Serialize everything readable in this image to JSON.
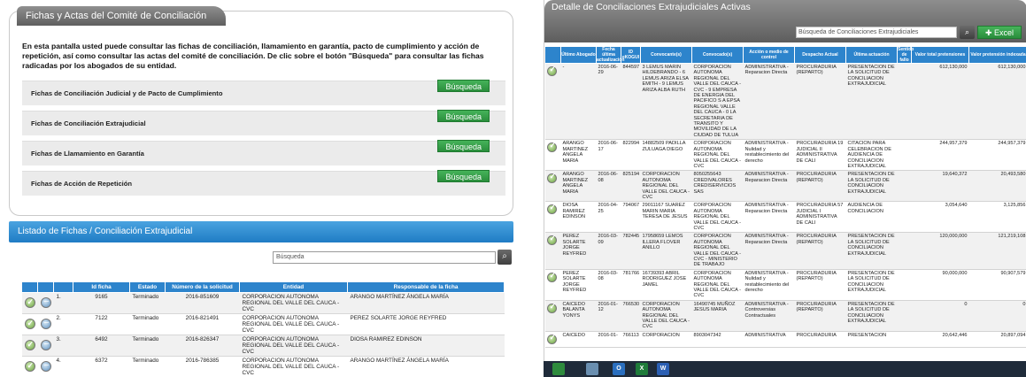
{
  "left": {
    "title": "Fichas y Actas del Comité de Conciliación",
    "intro": "En esta pantalla usted puede consultar las fichas de conciliación, llamamiento en garantía, pacto de cumplimiento y acción de repetición, así como consultar las actas del comité de conciliación. De clic sobre el botón \"Búsqueda\" para consultar las fichas radicadas por los abogados de su entidad.",
    "rows": [
      {
        "label": "Fichas de Conciliación Judicial y de Pacto de Cumplimiento",
        "button": "Búsqueda"
      },
      {
        "label": "Fichas de Conciliación Extrajudicial",
        "button": "Búsqueda"
      },
      {
        "label": "Fichas de Llamamiento en Garantía",
        "button": "Búsqueda"
      },
      {
        "label": "Fichas de Acción de Repetición",
        "button": "Búsqueda"
      }
    ],
    "list_title": "Listado de Fichas / Conciliación Extrajudicial",
    "search_placeholder": "Búsqueda",
    "table": {
      "headers": [
        "",
        "",
        "",
        "Id ficha",
        "Estado",
        "Número de la solicitud",
        "Entidad",
        "Responsable de la ficha"
      ],
      "rows": [
        {
          "n": "1.",
          "id": "9165",
          "estado": "Terminado",
          "sol": "2016-851609",
          "entidad": "CORPORACION AUTONOMA REGIONAL DEL VALLE DEL CAUCA -CVC",
          "resp": "ARANGO MARTÍNEZ ÁNGELA MARÍA"
        },
        {
          "n": "2.",
          "id": "7122",
          "estado": "Terminado",
          "sol": "2016-821491",
          "entidad": "CORPORACION AUTONOMA REGIONAL DEL VALLE DEL CAUCA -CVC",
          "resp": "PEREZ SOLARTE JORGE REYFRED"
        },
        {
          "n": "3.",
          "id": "6492",
          "estado": "Terminado",
          "sol": "2016-826347",
          "entidad": "CORPORACION AUTONOMA REGIONAL DEL VALLE DEL CAUCA -CVC",
          "resp": "DIOSA RAMIREZ EDINSON"
        },
        {
          "n": "4.",
          "id": "6372",
          "estado": "Terminado",
          "sol": "2016-786385",
          "entidad": "CORPORACION AUTONOMA REGIONAL DEL VALLE DEL CAUCA -CVC",
          "resp": "ARANGO MARTÍNEZ ÁNGELA MARÍA"
        }
      ]
    }
  },
  "right": {
    "title": "Detalle de Conciliaciones Extrajudiciales Activas",
    "search_placeholder": "Búsqueda de Conciliaciones Extrajudiciales",
    "excel_label": "Excel",
    "headers": [
      "",
      "Último Abogado",
      "Fecha última actualización",
      "ID eKOGUI",
      "Convocante(s)",
      "Convocado(s)",
      "Acción o medio de control",
      "Despacho Actual",
      "Última actuación",
      "Sentido de fallo",
      "Valor total pretensiones",
      "Valor pretensión indexada"
    ],
    "rows": [
      {
        "abog": "-",
        "fecha": "2016-06-29",
        "id": "844597",
        "convocante": "3 LEMUS MARIN HILDEBRANDO - 6 LEMUS ARIZA ELSA EMITH - 9 LEMUS ARIZA ALBA RUTH",
        "convocado": "CORPORACION AUTONOMA REGIONAL DEL VALLE DEL CAUCA -CVC - 9 EMPRESA DE ENERGIA DEL PACIFICO S A EPSA REGIONAL VALLE DEL CAUCA - 0 LA SECRETARIA DE TRANSITO Y MOVILIDAD DE LA CIUDAD DE TULUA",
        "accion": "ADMINISTRATIVA - Reparacion Directa",
        "despacho": "PROCURADURIA (REPARTO)",
        "ultima": "PRESENTACION DE LA SOLICITUD DE CONCILIACION EXTRAJUDICIAL",
        "sentido": "",
        "valor": "612,130,000",
        "indexada": "612,130,000"
      },
      {
        "abog": "ARANGO MARTINEZ ANGELA MARIA",
        "fecha": "2016-06-17",
        "id": "822994",
        "convocante": "14882509 PADILLA ZULUAGA DIEGO",
        "convocado": "CORPORACION AUTONOMA REGIONAL DEL VALLE DEL CAUCA -CVC",
        "accion": "ADMINISTRATIVA - Nulidad y restablecimiento del derecho",
        "despacho": "PROCURADURIA 19 JUDICIAL II ADMINISTRATIVA DE CALI",
        "ultima": "CITACION PARA CELEBRACION DE AUDIENCIA DE CONCILIACION EXTRAJUDICIAL",
        "sentido": "",
        "valor": "244,957,379",
        "indexada": "244,957,379"
      },
      {
        "abog": "ARANGO MARTINEZ ANGELA MARIA",
        "fecha": "2016-06-08",
        "id": "825194",
        "convocante": "CORPORACION AUTONOMA REGIONAL DEL VALLE DEL CAUCA -CVC",
        "convocado": "8050255643 CREDIVALORES CREDISERVICIOS SAS",
        "accion": "ADMINISTRATIVA - Reparacion Directa",
        "despacho": "PROCURADURIA (REPARTO)",
        "ultima": "PRESENTACION DE LA SOLICITUD DE CONCILIACION EXTRAJUDICIAL",
        "sentido": "",
        "valor": "19,640,372",
        "indexada": "20,493,580"
      },
      {
        "abog": "DIOSA RAMIREZ EDINSON",
        "fecha": "2016-04-25",
        "id": "794067",
        "convocante": "29011167 SUAREZ MARIN MARIA TERESA DE JESUS",
        "convocado": "CORPORACION AUTONOMA REGIONAL DEL VALLE DEL CAUCA -CVC",
        "accion": "ADMINISTRATIVA - Reparacion Directa",
        "despacho": "PROCURADURIA 57 JUDICIAL I ADMINISTRATIVA DE CALI",
        "ultima": "AUDIENCIA DE CONCILIACION",
        "sentido": "",
        "valor": "3,054,640",
        "indexada": "3,125,856"
      },
      {
        "abog": "PEREZ SOLARTE JORGE REYFRED",
        "fecha": "2016-03-09",
        "id": "782445",
        "convocante": "17958659 LEMOS ILLERA FLOVER ANILLO",
        "convocado": "CORPORACION AUTONOMA REGIONAL DEL VALLE DEL CAUCA -CVC - MINISTERIO DE TRABAJO",
        "accion": "ADMINISTRATIVA - Reparacion Directa",
        "despacho": "PROCURADURIA (REPARTO)",
        "ultima": "PRESENTACION DE LA SOLICITUD DE CONCILIACION EXTRAJUDICIAL",
        "sentido": "",
        "valor": "120,000,000",
        "indexada": "121,219,108"
      },
      {
        "abog": "PEREZ SOLARTE JORGE REYFRED",
        "fecha": "2016-03-08",
        "id": "781766",
        "convocante": "16739393 ABRIL RODRIGUEZ JOSE JAMEL",
        "convocado": "CORPORACION AUTONOMA REGIONAL DEL VALLE DEL CAUCA -CVC",
        "accion": "ADMINISTRATIVA - Nulidad y restablecimiento del derecho",
        "despacho": "PROCURADURIA (REPARTO)",
        "ultima": "PRESENTACION DE LA SOLICITUD DE CONCILIACION EXTRAJUDICIAL",
        "sentido": "",
        "valor": "90,000,000",
        "indexada": "90,907,579"
      },
      {
        "abog": "CAICEDO BALANTA YONYS",
        "fecha": "2016-01-12",
        "id": "766530",
        "convocante": "CORPORACION AUTONOMA REGIONAL DEL VALLE DEL CAUCA -CVC",
        "convocado": "16490745 MUÑOZ JESUS MARIA",
        "accion": "ADMINISTRATIVA - Controversias Contractuales",
        "despacho": "PROCURADURIA (REPARTO)",
        "ultima": "PRESENTACION DE LA SOLICITUD DE CONCILIACION EXTRAJUDICIAL",
        "sentido": "",
        "valor": "0",
        "indexada": "0"
      },
      {
        "abog": "CAICEDO",
        "fecha": "2016-01-",
        "id": "766113",
        "convocante": "CORPORACION",
        "convocado": "8903047342",
        "accion": "ADMINISTRATIVA",
        "despacho": "PROCURADURIA",
        "ultima": "PRESENTACION",
        "sentido": "",
        "valor": "20,642,446",
        "indexada": "20,897,094"
      }
    ]
  },
  "taskbar": {
    "items": [
      {
        "name": "windows-icon",
        "label": "",
        "color": "#2e8b3d"
      },
      {
        "name": "explorer-icon",
        "label": "",
        "color": "#6a8fb0"
      },
      {
        "name": "outlook-icon",
        "label": "O",
        "color": "#2a6fbf"
      },
      {
        "name": "excel-icon",
        "label": "X",
        "color": "#1e7b3a"
      },
      {
        "name": "word-icon",
        "label": "W",
        "color": "#2b5fb3"
      }
    ]
  },
  "colors": {
    "accent_blue": "#2d84cc",
    "green_button": "#2a8e3c",
    "header_gray": "#6f6f6f"
  }
}
